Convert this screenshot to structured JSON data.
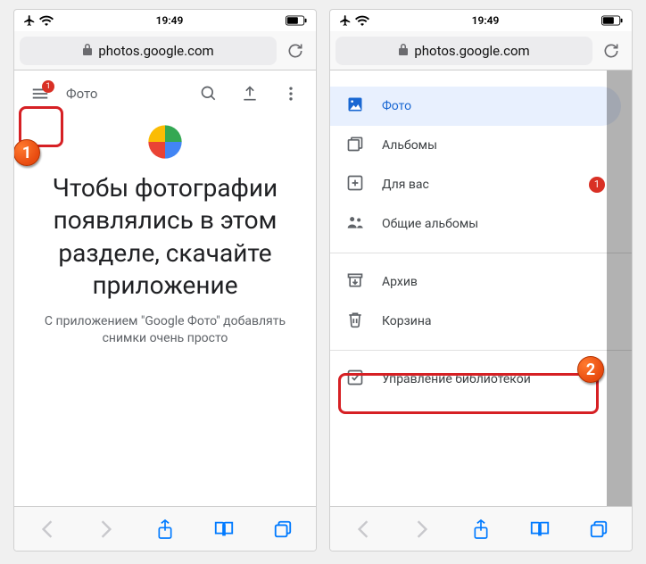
{
  "status": {
    "time": "19:49"
  },
  "browser": {
    "url": "photos.google.com"
  },
  "screen1": {
    "hamburger_badge": "1",
    "tab_label": "Фото",
    "promo_heading": "Чтобы фотографии появлялись в этом разделе, скачайте приложение",
    "promo_sub": "С приложением \"Google Фото\" добавлять снимки очень просто"
  },
  "menu": {
    "photos": "Фото",
    "albums": "Альбомы",
    "foryou": "Для вас",
    "foryou_badge": "1",
    "shared": "Общие альбомы",
    "archive": "Архив",
    "trash": "Корзина",
    "manage": "Управление библиотекой"
  },
  "callouts": {
    "one": "1",
    "two": "2"
  }
}
